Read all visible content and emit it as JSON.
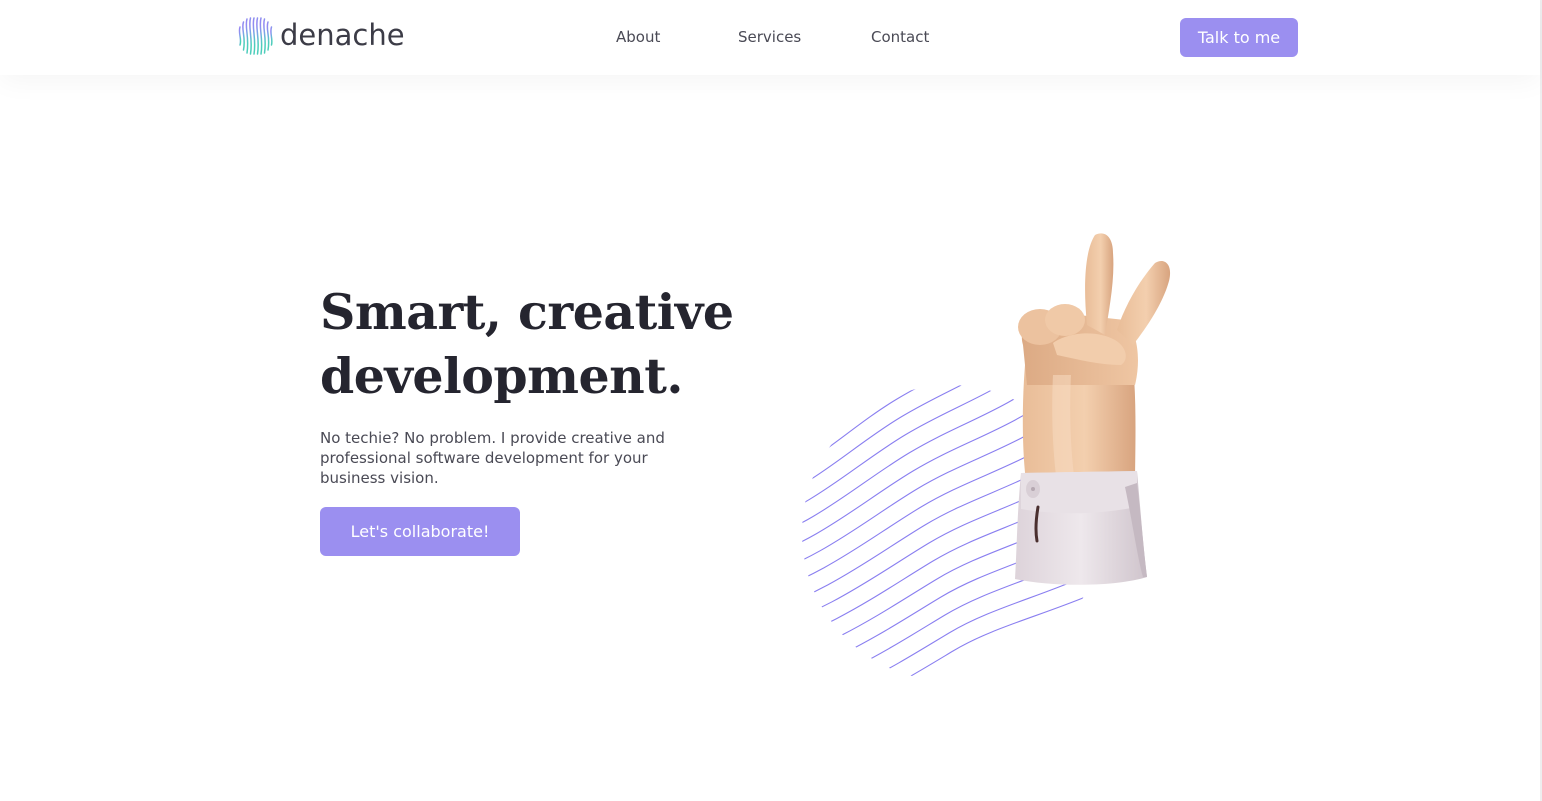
{
  "brand": {
    "name": "denache",
    "logo_icon": "wave-lines-logo-icon",
    "accent_color": "#9b8ff0"
  },
  "nav": {
    "links": [
      {
        "label": "About"
      },
      {
        "label": "Services"
      },
      {
        "label": "Contact"
      }
    ],
    "cta_label": "Talk to me"
  },
  "hero": {
    "title_line1": "Smart, creative",
    "title_line2": "development.",
    "description": "No techie? No problem. I provide creative and professional software development for your business vision.",
    "cta_label": "Let's collaborate!",
    "illustration": "peace-sign-hand-illustration",
    "pattern": "wavy-lines-circle-pattern"
  }
}
